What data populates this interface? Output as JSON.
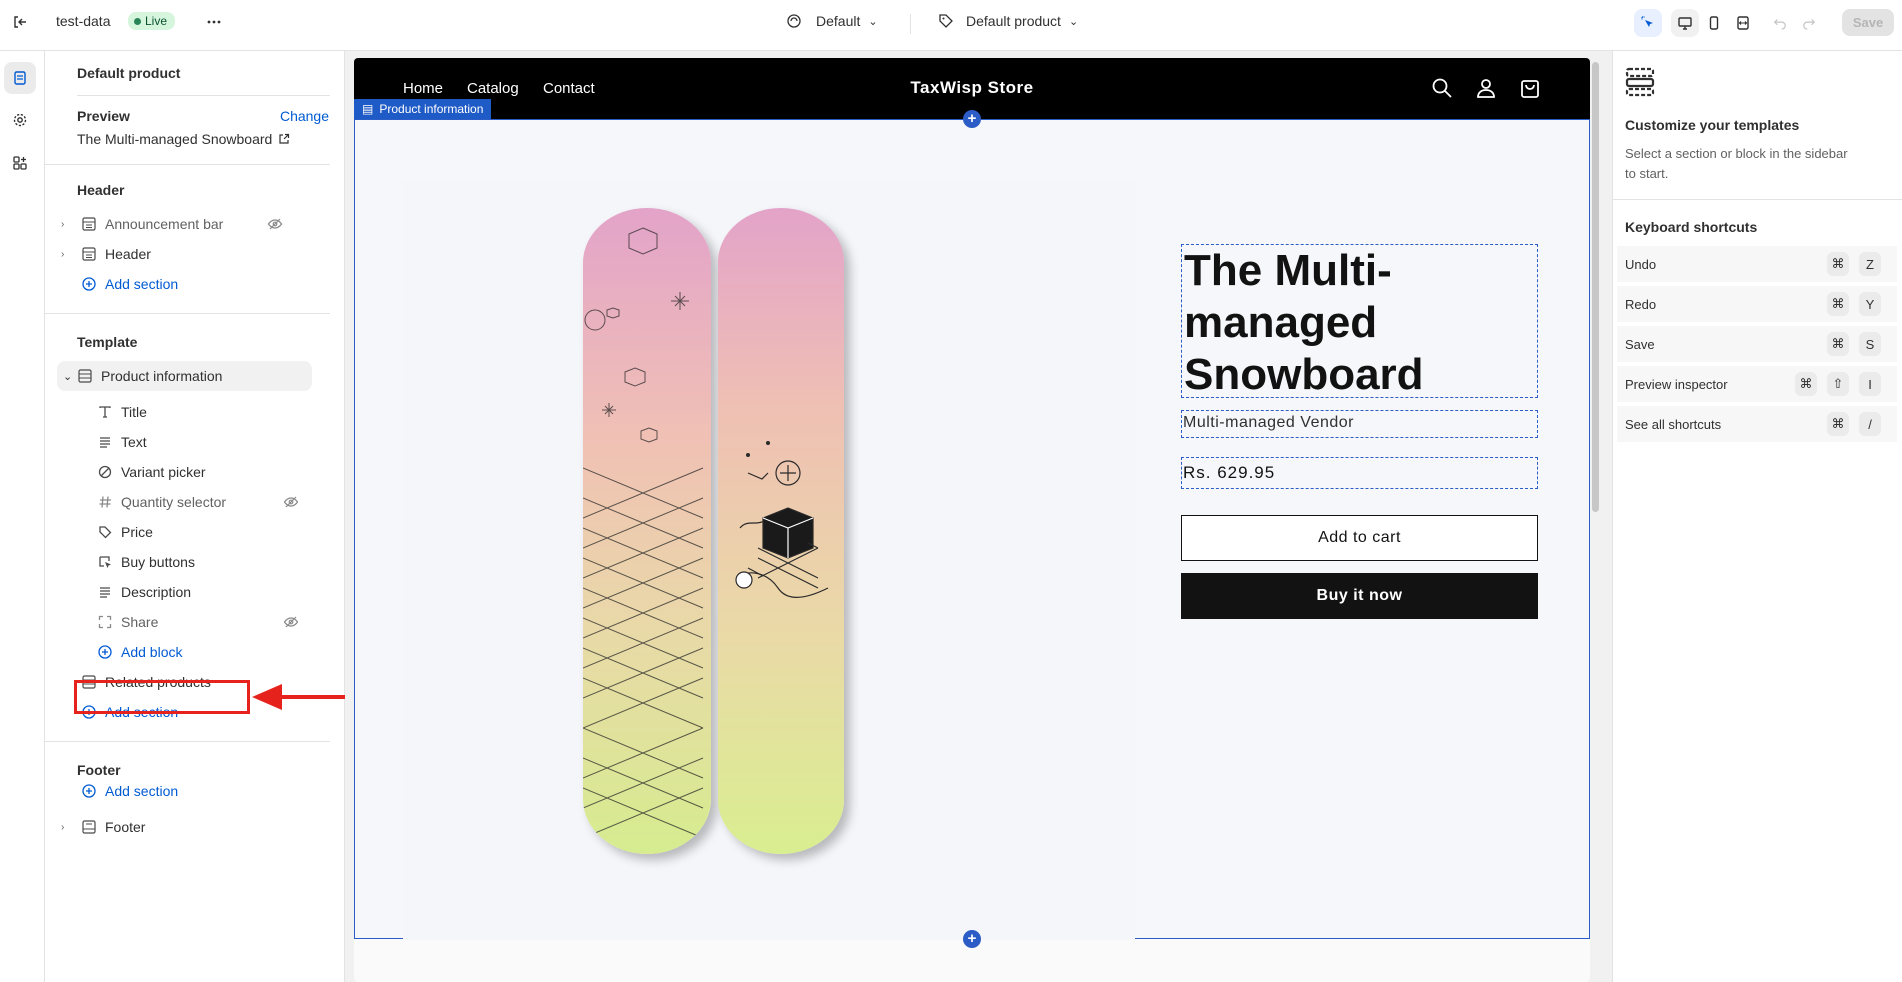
{
  "topbar": {
    "store_name": "test-data",
    "live_label": "Live",
    "theme_label": "Default",
    "template_label": "Default product",
    "save_label": "Save"
  },
  "sidebar": {
    "title": "Default product",
    "preview_label": "Preview",
    "change_label": "Change",
    "preview_product": "The Multi-managed Snowboard",
    "header_heading": "Header",
    "header_items": [
      {
        "label": "Announcement bar",
        "icon": "section-icon",
        "hidden": true
      },
      {
        "label": "Header",
        "icon": "section-icon",
        "hidden": false
      }
    ],
    "add_section_label": "Add section",
    "template_heading": "Template",
    "product_info_label": "Product information",
    "blocks": [
      {
        "label": "Title",
        "icon": "text-type-icon",
        "hidden": false
      },
      {
        "label": "Text",
        "icon": "text-lines-icon",
        "hidden": false
      },
      {
        "label": "Variant picker",
        "icon": "variant-icon",
        "hidden": false
      },
      {
        "label": "Quantity selector",
        "icon": "hash-icon",
        "hidden": true
      },
      {
        "label": "Price",
        "icon": "price-tag-icon",
        "hidden": false
      },
      {
        "label": "Buy buttons",
        "icon": "cursor-click-icon",
        "hidden": false
      },
      {
        "label": "Description",
        "icon": "text-lines-icon",
        "hidden": false
      },
      {
        "label": "Share",
        "icon": "share-icon",
        "hidden": true
      }
    ],
    "add_block_label": "Add block",
    "related_products_label": "Related products",
    "footer_heading": "Footer",
    "footer_label": "Footer"
  },
  "preview": {
    "nav_links": [
      "Home",
      "Catalog",
      "Contact"
    ],
    "store_title": "TaxWisp Store",
    "section_tag": "Product information",
    "product_title": "The Multi-managed Snowboard",
    "vendor": "Multi-managed Vendor",
    "price": "Rs. 629.95",
    "add_to_cart": "Add to cart",
    "buy_now": "Buy it now"
  },
  "right_panel": {
    "title": "Customize your templates",
    "description": "Select a section or block in the sidebar to start.",
    "shortcuts_heading": "Keyboard shortcuts",
    "shortcuts": [
      {
        "label": "Undo",
        "keys": [
          "⌘",
          "Z"
        ]
      },
      {
        "label": "Redo",
        "keys": [
          "⌘",
          "Y"
        ]
      },
      {
        "label": "Save",
        "keys": [
          "⌘",
          "S"
        ]
      },
      {
        "label": "Preview inspector",
        "keys": [
          "⌘",
          "⇧",
          "I"
        ]
      },
      {
        "label": "See all shortcuts",
        "keys": [
          "⌘",
          "/"
        ]
      }
    ]
  },
  "colors": {
    "accent": "#005bd3",
    "selection": "#2c5cc5",
    "annotation": "#e5221c",
    "live_badge": "#d5f5dc"
  }
}
